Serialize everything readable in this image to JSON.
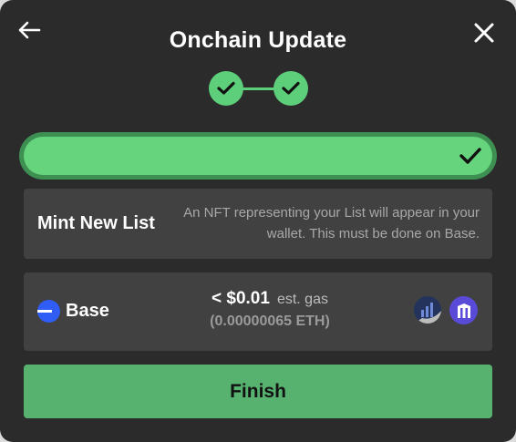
{
  "header": {
    "title": "Onchain Update",
    "back_icon": "arrow-left-icon",
    "close_icon": "close-icon"
  },
  "steps": [
    {
      "state": "complete",
      "icon": "check-icon"
    },
    {
      "state": "complete",
      "icon": "check-icon"
    }
  ],
  "progress": {
    "fraction": 1.0,
    "status_icon": "check-icon"
  },
  "mint_card": {
    "heading": "Mint New List",
    "description": "An NFT representing your List will appear in your wallet. This must be done on Base."
  },
  "gas_card": {
    "network": "Base",
    "gas_amount": "< $0.01",
    "gas_unit": "est. gas",
    "gas_eth": "(0.00000065 ETH)",
    "providers": [
      "bar-chart-logo-icon",
      "building-logo-icon"
    ]
  },
  "finish_button": {
    "label": "Finish"
  },
  "colors": {
    "background": "#2b2b2b",
    "card": "#414141",
    "accent_green": "#5dce7a",
    "button_green": "#58b26f",
    "base_blue": "#2f5df5"
  }
}
